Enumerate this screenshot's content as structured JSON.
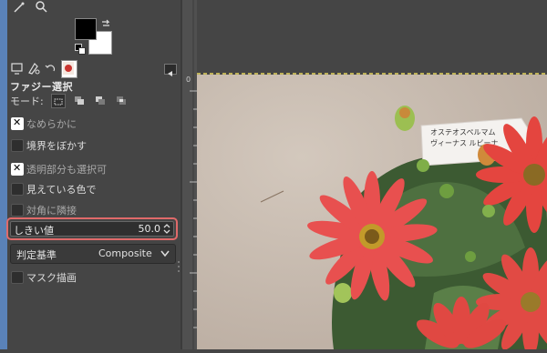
{
  "panel": {
    "title": "ファジー選択",
    "mode_label": "モード:",
    "options": [
      {
        "label": "なめらかに",
        "checked": true,
        "enabled": false
      },
      {
        "label": "境界をぼかす",
        "checked": false,
        "enabled": true
      },
      {
        "label": "透明部分も選択可",
        "checked": true,
        "enabled": false
      },
      {
        "label": "見えている色で",
        "checked": false,
        "enabled": true
      },
      {
        "label": "対角に隣接",
        "checked": false,
        "enabled": false
      }
    ],
    "threshold": {
      "label": "しきい値",
      "value": "50.0"
    },
    "criterion": {
      "label": "判定基準",
      "value": "Composite"
    },
    "mask_option": {
      "label": "マスク描画",
      "checked": false
    }
  },
  "canvas": {
    "sign_line1": "オステオスペルマム",
    "sign_line2": "ヴィーナス ルビーナ"
  },
  "colors": {
    "accent": "#5a82b8",
    "highlight": "#e06a6a",
    "panel_bg": "#454545",
    "flower": "#e8504f"
  }
}
